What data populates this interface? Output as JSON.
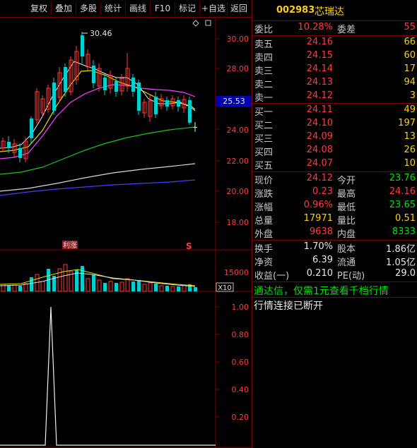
{
  "toolbar": {
    "buttons": [
      "复权",
      "叠加",
      "多股",
      "统计",
      "画线",
      "F10",
      "标记",
      "+自选",
      "返回"
    ]
  },
  "main_chart": {
    "high_label": "30.46",
    "current_price_tag": "25.53",
    "y_ticks": [
      "30.00",
      "28.00",
      "26.00",
      "24.00",
      "22.00",
      "20.00",
      "18.00"
    ],
    "marker_text": "S",
    "tag_text": "利涨"
  },
  "volume_chart": {
    "y_tick": "15000",
    "multiplier": "X10"
  },
  "indicator_chart": {
    "y_ticks": [
      "1.00",
      "0.80",
      "0.60",
      "0.40",
      "0.20"
    ]
  },
  "stock": {
    "code": "002983",
    "name": "芯瑞达"
  },
  "order_book": {
    "weibi_label": "委比",
    "weibi_value": "10.28%",
    "weicha_label": "委差",
    "weicha_value": "55",
    "asks": [
      {
        "label": "卖五",
        "price": "24.16",
        "volume": "66"
      },
      {
        "label": "卖四",
        "price": "24.15",
        "volume": "60"
      },
      {
        "label": "卖三",
        "price": "24.14",
        "volume": "17"
      },
      {
        "label": "卖二",
        "price": "24.13",
        "volume": "94"
      },
      {
        "label": "卖一",
        "price": "24.12",
        "volume": "3"
      }
    ],
    "bids": [
      {
        "label": "买一",
        "price": "24.11",
        "volume": "49"
      },
      {
        "label": "买二",
        "price": "24.10",
        "volume": "197"
      },
      {
        "label": "买三",
        "price": "24.09",
        "volume": "13"
      },
      {
        "label": "买四",
        "price": "24.08",
        "volume": "26"
      },
      {
        "label": "买五",
        "price": "24.07",
        "volume": "10"
      }
    ]
  },
  "quote": {
    "rows": [
      {
        "l1": "现价",
        "v1": "24.12",
        "c1": "red",
        "l2": "今开",
        "v2": "23.76",
        "c2": "green"
      },
      {
        "l1": "涨跌",
        "v1": "0.23",
        "c1": "red",
        "l2": "最高",
        "v2": "24.16",
        "c2": "red"
      },
      {
        "l1": "涨幅",
        "v1": "0.96%",
        "c1": "red",
        "l2": "最低",
        "v2": "23.65",
        "c2": "green"
      },
      {
        "l1": "总量",
        "v1": "17971",
        "c1": "yellow",
        "l2": "量比",
        "v2": "0.51",
        "c2": "yellow"
      },
      {
        "l1": "外盘",
        "v1": "9638",
        "c1": "red",
        "l2": "内盘",
        "v2": "8333",
        "c2": "green"
      }
    ],
    "rows2": [
      {
        "l1": "换手",
        "v1": "1.70%",
        "l2": "股本",
        "v2": "1.86亿"
      },
      {
        "l1": "净资",
        "v1": "6.39",
        "l2": "流通",
        "v2": "1.05亿"
      },
      {
        "l1": "收益(一)",
        "v1": "0.210",
        "l2": "PE(动)",
        "v2": "29.0"
      }
    ]
  },
  "notices": {
    "line1": "通达信，仅需1元查看千档行情",
    "line2": "行情连接已断开"
  },
  "colors": {
    "up": "#ff3c3c",
    "down": "#00e000",
    "border": "#800000",
    "accent": "#ffd000"
  }
}
